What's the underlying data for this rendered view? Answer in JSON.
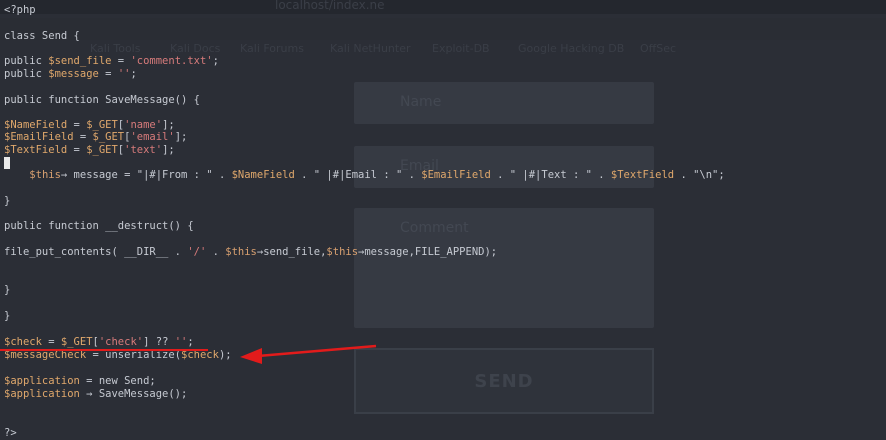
{
  "background_page": {
    "url_text": "localhost/index.ne",
    "bookmarks": [
      "Kali Tools",
      "Kali Docs",
      "Kali Forums",
      "Kali NetHunter",
      "Exploit-DB",
      "Google Hacking DB",
      "OffSec"
    ],
    "fields": {
      "name_placeholder": "Name",
      "email_placeholder": "Email",
      "comment_placeholder": "Comment"
    },
    "send_label": "SEND"
  },
  "code": {
    "lines": [
      "<?php",
      "",
      "class Send {",
      "",
      "public $send_file = 'comment.txt';",
      "public $message = '';",
      "",
      "public function SaveMessage() {",
      "",
      "$NameField = $_GET['name'];",
      "$EmailField = $_GET['email'];",
      "$TextField = $_GET['text'];",
      "",
      "    $this→ message = \"|#|From : \" . $NameField . \" |#|Email : \" . $EmailField . \" |#|Text : \" . $TextField . \"\\n\";",
      "",
      "}",
      "",
      "public function __destruct() {",
      "",
      "file_put_contents( __DIR__ . '/' . $this→send_file,$this→message,FILE_APPEND);",
      "",
      "",
      "}",
      "",
      "}",
      "",
      "$check = $_GET['check'] ?? '';",
      "$messageCheck = unserialize($check);",
      "",
      "$application = new Send;",
      "$application → SaveMessage();",
      "",
      "",
      "?>"
    ]
  },
  "colors": {
    "annotation_red": "#e21b1b",
    "background": "#2a2d35"
  }
}
